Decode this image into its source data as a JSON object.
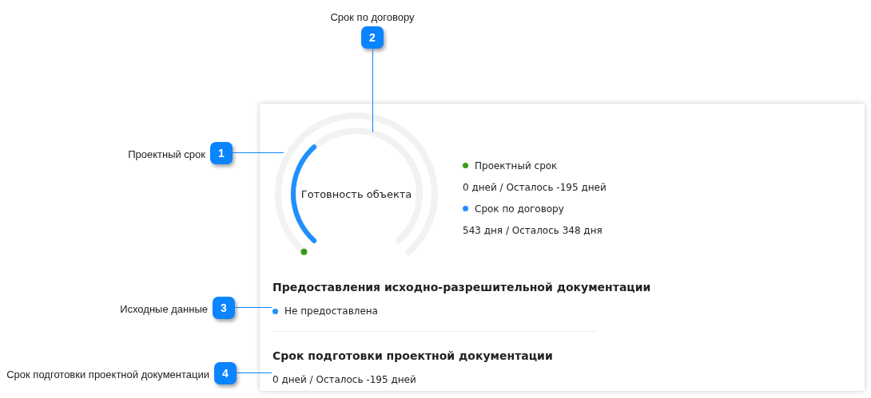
{
  "gauge": {
    "title": "Готовность объекта",
    "rings": [
      {
        "kind": "dot",
        "color": "#3a9a12"
      },
      {
        "kind": "arc",
        "color": "#1e8fff"
      }
    ]
  },
  "legend": [
    {
      "name": "Проектный срок",
      "color": "#3a9a12",
      "value": "0 дней / Осталось -195 дней"
    },
    {
      "name": "Срок по договору",
      "color": "#1e8fff",
      "value": "543 дня / Осталось 348 дня"
    }
  ],
  "sections": [
    {
      "title": "Предоставления исходно-разрешительной документации",
      "status": {
        "text": "Не предоставлена",
        "color": "#1e8fff"
      }
    },
    {
      "title": "Срок подготовки проектной документации",
      "value": "0 дней / Осталось -195 дней"
    }
  ],
  "callouts": [
    {
      "number": "1",
      "label": "Проектный срок"
    },
    {
      "number": "2",
      "label": "Срок по договору"
    },
    {
      "number": "3",
      "label": "Исходные данные"
    },
    {
      "number": "4",
      "label": "Срок подготовки проектной документации"
    }
  ]
}
